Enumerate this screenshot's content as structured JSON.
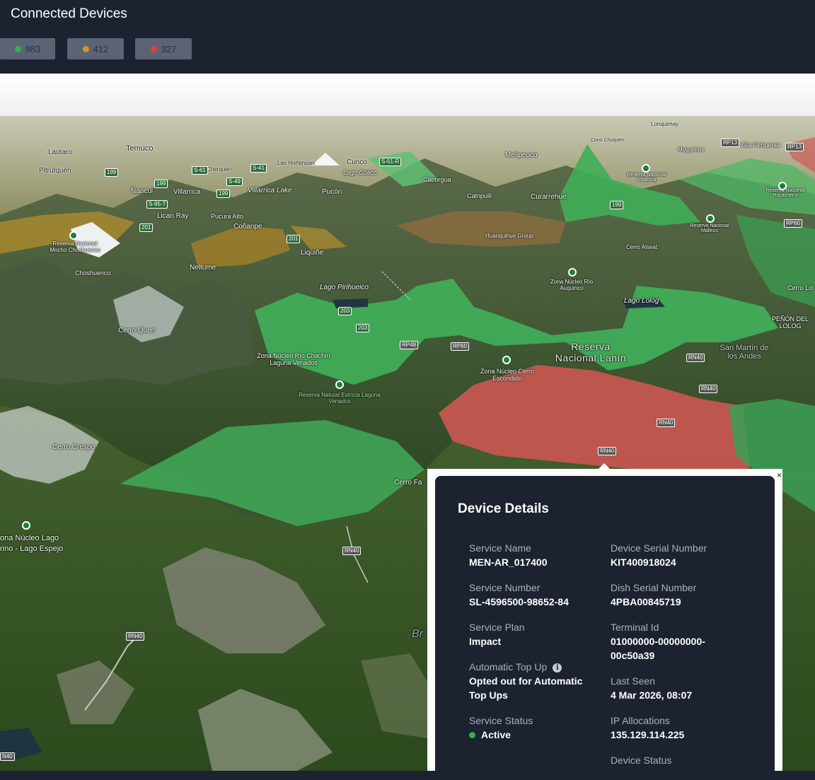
{
  "header": {
    "title": "Connected Devices",
    "counts": [
      {
        "value": "983",
        "color": "#2fb34a"
      },
      {
        "value": "412",
        "color": "#e0922a"
      },
      {
        "value": "327",
        "color": "#e0403a"
      }
    ]
  },
  "map": {
    "labels": {
      "temuco": "Temuco",
      "lautaro": "Lautaro",
      "pitrufquen": "Pitrufquén",
      "nancul": "Ñancul",
      "villarrica": "Villarrica",
      "villarrica_lake": "Villarrica Lake",
      "lican_ray": "Lican Ray",
      "pucura_alto": "Pucura Alto",
      "conaripe": "Coñaripe",
      "liquine": "Liquiñe",
      "neltume": "Neltume",
      "choshuenco": "Choshuenco",
      "reserva_mocho": "Reserva Nacional Mocho Choshuenco",
      "pucon": "Pucón",
      "cunco": "Cunco",
      "lago_colico": "Lago Colico",
      "las_hortensias": "Las Hortensias",
      "cherquen": "Cherquén",
      "caburgua": "Caburgua",
      "catripulli": "Catripulli",
      "curarrehue": "Curarrehue",
      "melipeuco": "Melipeuco",
      "huanquihue": "Huanquihue Group",
      "cerro_alseat": "Cerro Alseat",
      "reserva_villarrica": "Reserva Nacional Villarrica",
      "lonquimay": "Lonquimay",
      "cono_chuquen": "Cono Chuquen",
      "moguehue": "Moguehue",
      "villa_pehuenia": "Villa Pehuenia",
      "reserva_ruca": "Reserva Nacional Rucacheroi",
      "reserva_malleco": "Reserva Nacional Malleco",
      "lago_pirihueico": "Lago Pirihueico",
      "cerro_quen": "Cerro Quen",
      "zona_rio_chachin": "Zona Núcleo Río Chachín Laguna Venados",
      "reserva_estricta": "Reserva Natural Estricta Laguna Venados",
      "zona_rio_auquinco": "Zona Núcleo Río Auquinco",
      "lago_lolog": "Lago Lolog",
      "reserva_lanin": "Reserva Nacional Lanín",
      "zona_cerro_escondido": "Zona Núcleo Cerro Escondido",
      "san_martin": "San Martín de los Andes",
      "penon_lolog": "PEÑÓN DEL LOLOG",
      "cerro_lol": "Cerro Lol",
      "cerro_crespo": "Cerro Crespo",
      "cerro_fa": "Cerro Fa",
      "zona_lago_espejo": "ona Núcleo Lago",
      "zona_lago_espejo2": "rino - Lago Espejo",
      "br": "Br"
    },
    "roads": {
      "r199a": "199",
      "r199b": "199",
      "r199c": "199",
      "r199d": "199",
      "r201a": "201",
      "r201b": "201",
      "r203a": "203",
      "r203b": "203",
      "rp48": "RP48",
      "rp60a": "RP60",
      "rp60b": "RP60",
      "rn40a": "RN40",
      "rn40b": "RN40",
      "rn40c": "RN40",
      "rn40d": "RN40",
      "rn40e": "RN40",
      "rn40f": "RN40",
      "rn40g": "N40",
      "rp13a": "RP13",
      "rp13b": "RP13",
      "s95t": "S-95-T",
      "s61": "S-61",
      "s49": "S-49",
      "s51r": "S-51-R",
      "s41": "S-41"
    }
  },
  "device_details": {
    "title": "Device Details",
    "close_label": "×",
    "left": {
      "service_name_label": "Service Name",
      "service_name": "MEN-AR_017400",
      "service_number_label": "Service Number",
      "service_number": "SL-4596500-98652-84",
      "service_plan_label": "Service Plan",
      "service_plan": "Impact",
      "auto_top_up_label": "Automatic Top Up",
      "auto_top_up_line1": "Opted out for Automatic",
      "auto_top_up_line2": "Top Ups",
      "service_status_label": "Service Status",
      "service_status": "Active",
      "service_status_color": "#2fb34a"
    },
    "right": {
      "serial_label": "Device Serial Number",
      "serial": "KIT400918024",
      "dish_label": "Dish Serial Number",
      "dish": "4PBA00845719",
      "terminal_label": "Terminal Id",
      "terminal_line1": "01000000-00000000-",
      "terminal_line2": "00c50a39",
      "last_seen_label": "Last Seen",
      "last_seen": "4 Mar 2026, 08:07",
      "ip_label": "IP Allocations",
      "ip": "135.129.114.225",
      "device_status_label": "Device Status"
    }
  }
}
